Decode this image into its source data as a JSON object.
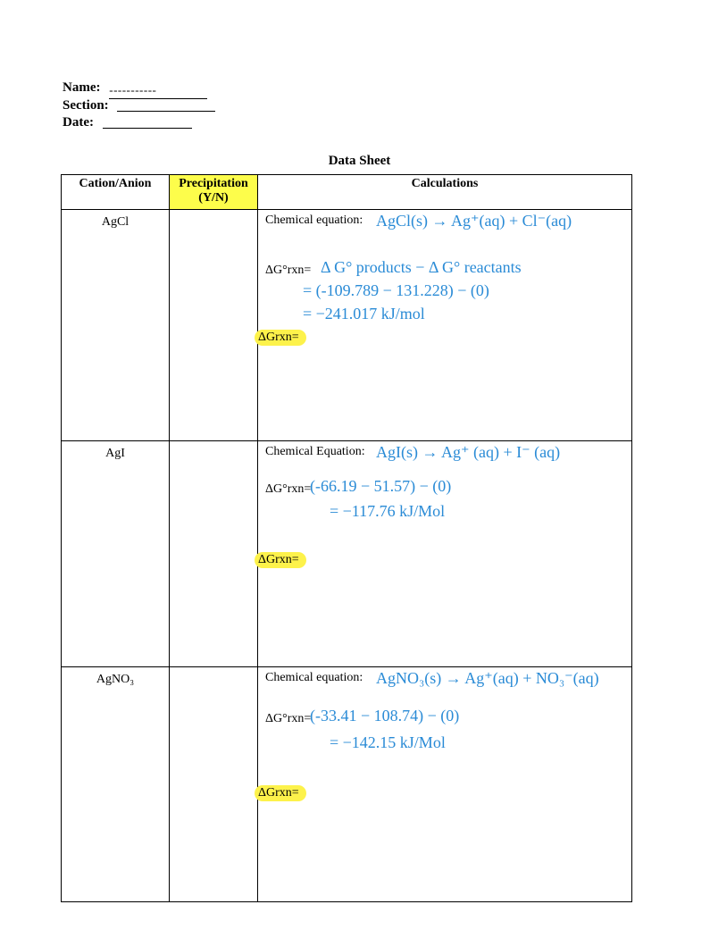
{
  "header": {
    "name_label": "Name:",
    "name_value": "-----------",
    "section_label": "Section:",
    "date_label": "Date:"
  },
  "title": "Data Sheet",
  "columns": {
    "cation_anion": "Cation/Anion",
    "precipitation": "Precipitation (Y/N)",
    "calculations": "Calculations"
  },
  "row_labels": {
    "chem_eq": "Chemical equation:",
    "chem_eq_cap": "Chemical Equation:",
    "dg_std": "ΔG°rxn=",
    "dg": "ΔGrxn="
  },
  "rows": [
    {
      "compound": "AgCl",
      "hw_eq": "AgCl(s) → Ag⁺(aq) + Cl⁻(aq)",
      "hw_line1": "Δ G° products − Δ G° reactants",
      "hw_line2": "= (-109.789 − 131.228) − (0)",
      "hw_line3": "= −241.017 kJ/mol"
    },
    {
      "compound": "AgI",
      "hw_eq": "AgI(s) → Ag⁺ (aq) + I⁻ (aq)",
      "hw_line1": "(-66.19 − 51.57) − (0)",
      "hw_line2": "= −117.76 kJ/Mol"
    },
    {
      "compound": "AgNO₃",
      "hw_eq": "AgNO₃(s) → Ag⁺(aq) + NO₃⁻(aq)",
      "hw_line1": "(-33.41 − 108.74) − (0)",
      "hw_line2": "= −142.15 kJ/Mol"
    }
  ]
}
